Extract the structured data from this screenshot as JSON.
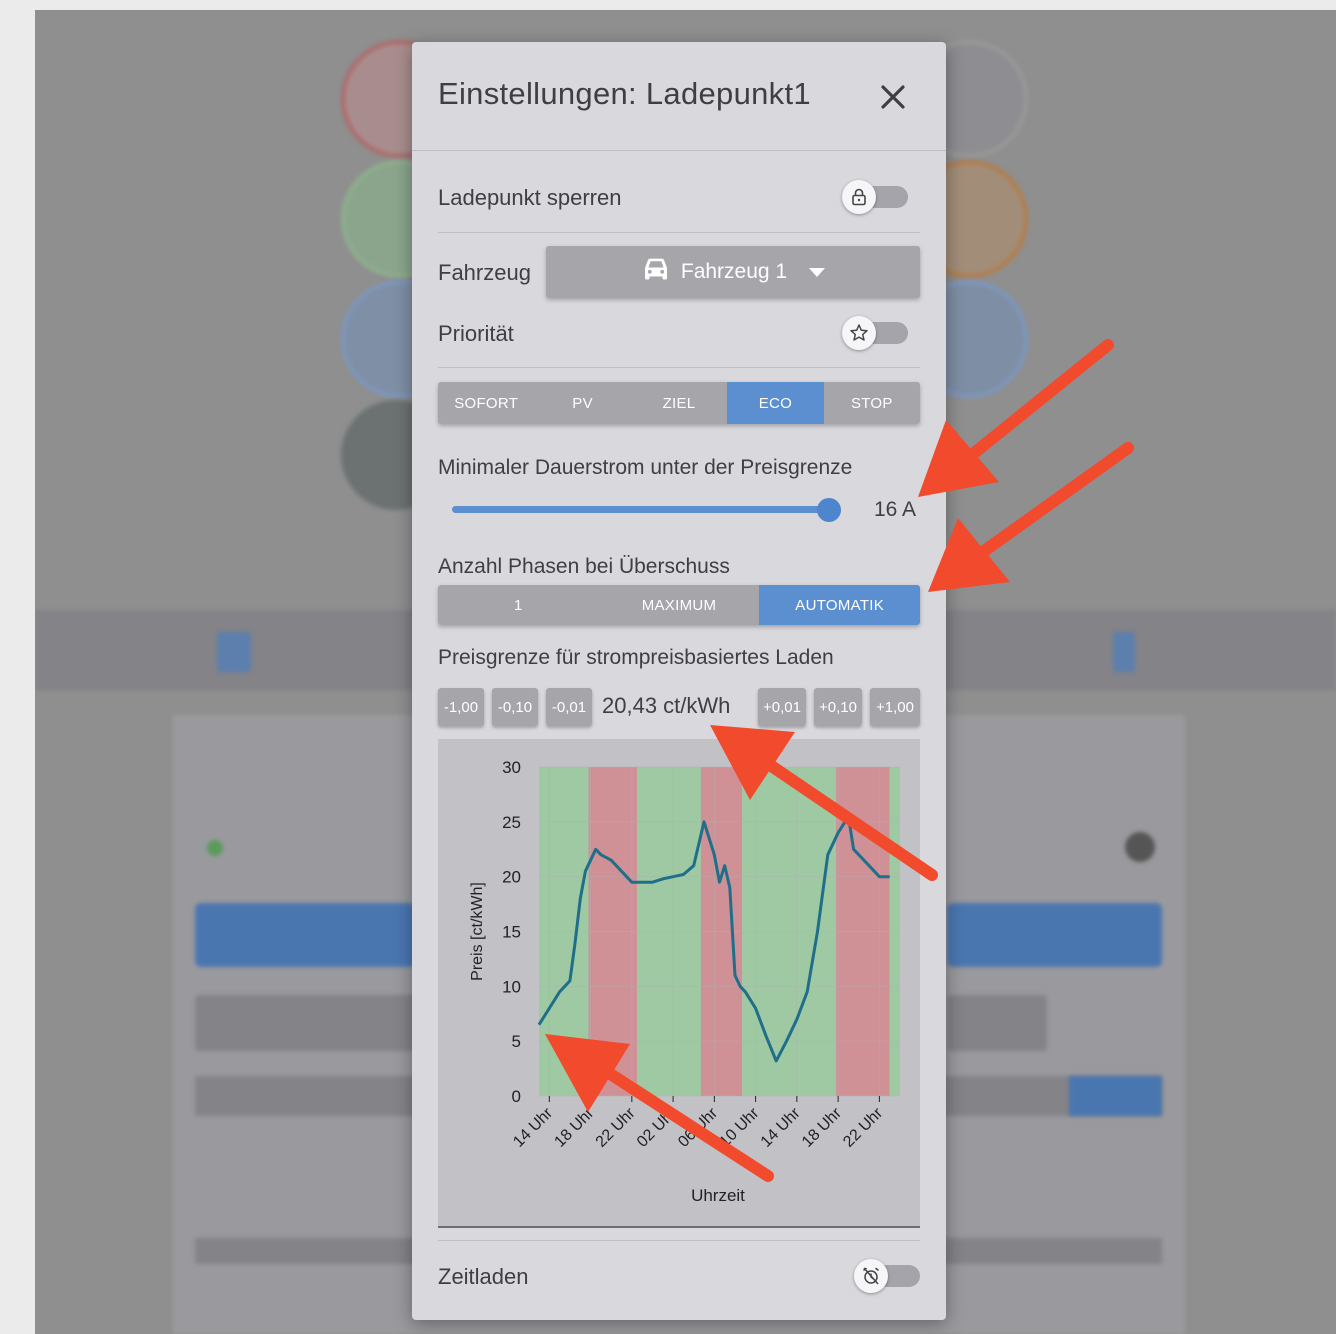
{
  "dialog": {
    "title": "Einstellungen:  Ladepunkt1",
    "close_icon": "close-icon"
  },
  "lock": {
    "label": "Ladepunkt sperren",
    "icon": "lock-icon",
    "enabled": false
  },
  "vehicle": {
    "label": "Fahrzeug",
    "selected": "Fahrzeug 1",
    "icon": "car-icon"
  },
  "priority": {
    "label": "Priorität",
    "icon": "star-icon",
    "enabled": false
  },
  "mode": {
    "options": [
      "SOFORT",
      "PV",
      "ZIEL",
      "ECO",
      "STOP"
    ],
    "active": "ECO"
  },
  "min_current": {
    "label": "Minimaler Dauerstrom unter der Preisgrenze",
    "value": "16 A",
    "fraction": 1.0
  },
  "phases": {
    "label": "Anzahl Phasen bei Überschuss",
    "options": [
      "1",
      "MAXIMUM",
      "AUTOMATIK"
    ],
    "active": "AUTOMATIK"
  },
  "price_limit": {
    "label": "Preisgrenze für strompreisbasiertes Laden",
    "minus": [
      "-1,00",
      "-0,10",
      "-0,01"
    ],
    "plus": [
      "+0,01",
      "+0,10",
      "+1,00"
    ],
    "value": "20,43 ct/kWh"
  },
  "timed_charging": {
    "label": "Zeitladen",
    "icon": "alarm-off-icon",
    "enabled": false
  },
  "colors": {
    "accent": "#5b8fd0",
    "green_band": "#9ec9a2",
    "red_band": "#cf9196",
    "line": "#1f6f8b",
    "arrow": "#f24a2c"
  },
  "chart_data": {
    "type": "line",
    "xlabel": "Uhrzeit",
    "ylabel": "Preis [ct/kWh]",
    "ylim": [
      0,
      30
    ],
    "yticks": [
      0,
      5,
      10,
      15,
      20,
      25,
      30
    ],
    "xticks": [
      "14 Uhr",
      "18 Uhr",
      "22 Uhr",
      "02 Uhr",
      "06 Uhr",
      "10 Uhr",
      "14 Uhr",
      "18 Uhr",
      "22 Uhr"
    ],
    "x_range_hours": [
      13,
      48
    ],
    "grid": true,
    "x": [
      13,
      14,
      15,
      16,
      16.5,
      17,
      17.5,
      18,
      18.5,
      19,
      20,
      21,
      22,
      23,
      24,
      25,
      26,
      27,
      28,
      29,
      30,
      30.5,
      31,
      31.5,
      32,
      32.5,
      33,
      34,
      35,
      36,
      37,
      38,
      39,
      40,
      41,
      42,
      43,
      43.5,
      44,
      45,
      46,
      47
    ],
    "y": [
      6.5,
      8,
      9.5,
      10.5,
      14,
      18,
      20.5,
      21.5,
      22.5,
      22,
      21.5,
      20.5,
      19.5,
      19.5,
      19.5,
      19.8,
      20,
      20.2,
      21,
      25,
      22,
      19.5,
      21,
      19,
      11,
      10,
      9.5,
      8,
      5.5,
      3.2,
      5,
      7,
      9.5,
      15,
      22,
      24,
      25.5,
      22.5,
      22,
      21,
      20,
      20
    ],
    "bands": [
      {
        "from": 13,
        "to": 17.8,
        "color": "green"
      },
      {
        "from": 17.8,
        "to": 22.5,
        "color": "red"
      },
      {
        "from": 22.5,
        "to": 28.7,
        "color": "green"
      },
      {
        "from": 28.7,
        "to": 32.7,
        "color": "red"
      },
      {
        "from": 32.7,
        "to": 41.8,
        "color": "green"
      },
      {
        "from": 41.8,
        "to": 47,
        "color": "red"
      },
      {
        "from": 47,
        "to": 48,
        "color": "green"
      }
    ]
  }
}
